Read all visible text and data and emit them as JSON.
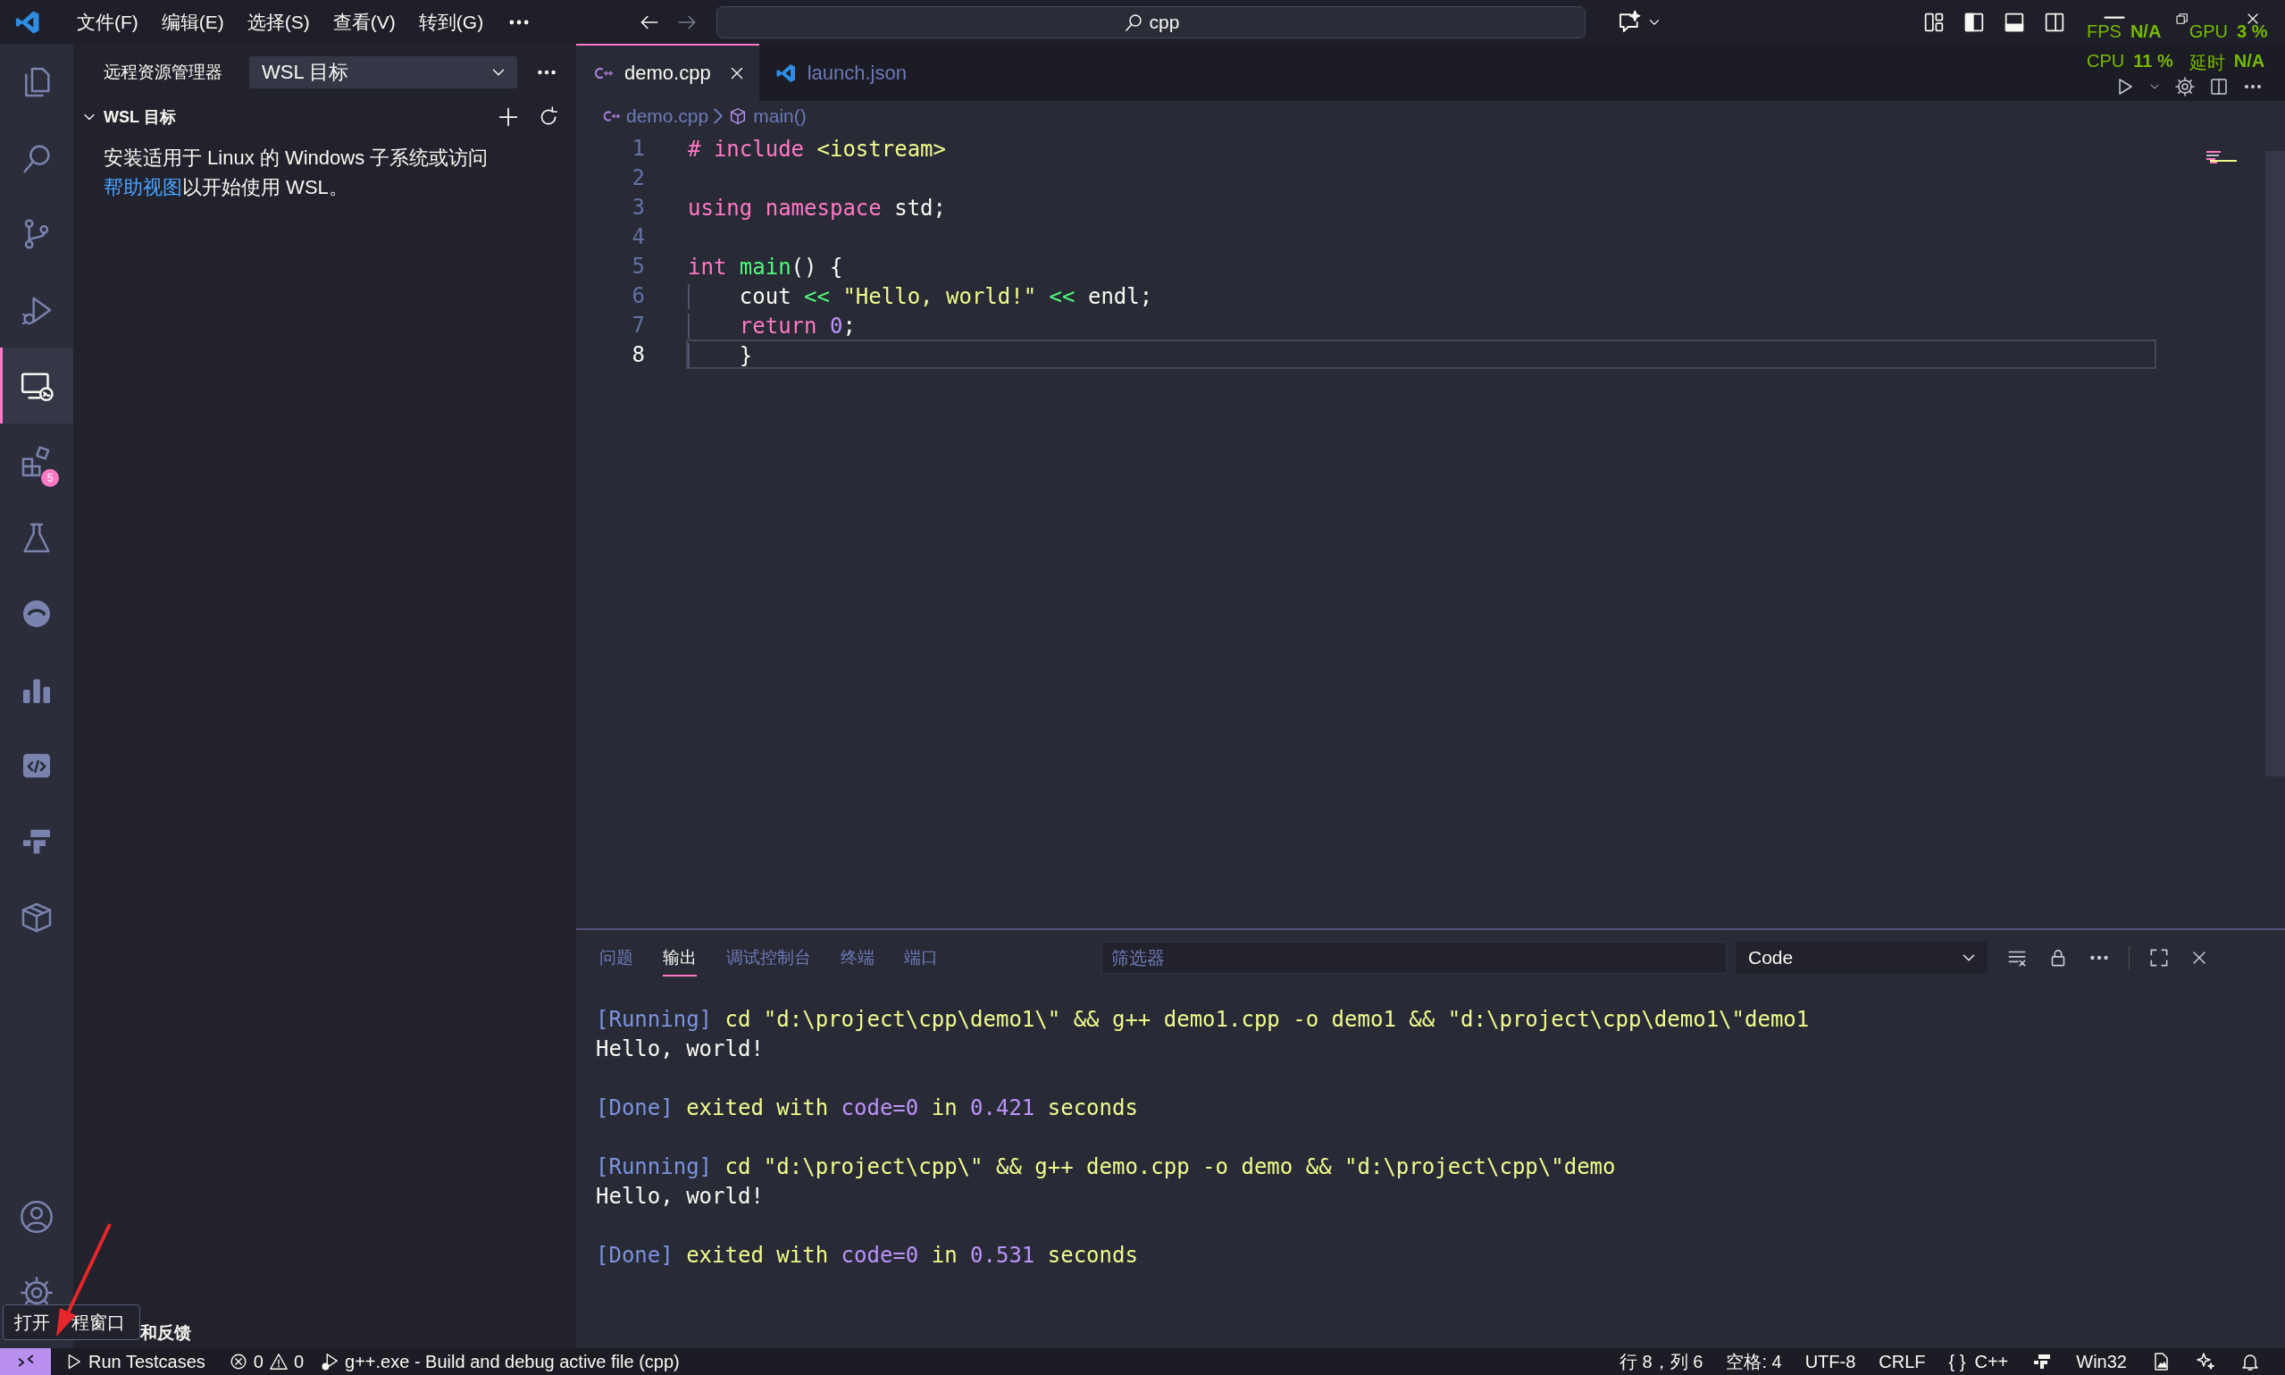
{
  "title_bar": {
    "menus": [
      "文件(F)",
      "编辑(E)",
      "选择(S)",
      "查看(V)",
      "转到(G)"
    ],
    "search": "cpp"
  },
  "activity_bar": {
    "items": [
      {
        "kind": "files",
        "selected": false
      },
      {
        "kind": "search",
        "selected": false
      },
      {
        "kind": "source-control",
        "selected": false
      },
      {
        "kind": "run-debug",
        "selected": false
      },
      {
        "kind": "remote",
        "selected": true
      },
      {
        "kind": "extensions",
        "selected": false,
        "badge": "5"
      },
      {
        "kind": "testing",
        "selected": false
      },
      {
        "kind": "round",
        "selected": false
      },
      {
        "kind": "chart",
        "selected": false
      },
      {
        "kind": "code-box",
        "selected": false
      },
      {
        "kind": "steps",
        "selected": false
      },
      {
        "kind": "package",
        "selected": false
      }
    ],
    "bottom": [
      {
        "kind": "account"
      },
      {
        "kind": "settings"
      }
    ]
  },
  "sidebar": {
    "title": "远程资源管理器",
    "target": "WSL 目标",
    "section": {
      "title": "WSL 目标",
      "expanded": true
    },
    "message": {
      "before": "安装适用于 Linux 的 Windows 子系统或访问",
      "link": "帮助视图",
      "after": "以开始使用 WSL。"
    },
    "footer_section": "和反馈"
  },
  "editor": {
    "tabs": [
      {
        "label": "demo.cpp",
        "kind": "cpp",
        "selected": true
      },
      {
        "label": "launch.json",
        "kind": "vscode",
        "selected": false
      }
    ],
    "breadcrumb": [
      {
        "label": "demo.cpp",
        "kind": "cpp"
      },
      {
        "label": "main()",
        "kind": "symbol"
      }
    ],
    "lines": [
      {
        "number": "1",
        "current": false,
        "tokens": [
          {
            "text": "# include",
            "kind": "keyword"
          },
          {
            "text": " <iostream>",
            "kind": "string"
          }
        ]
      },
      {
        "number": "2",
        "current": false
      },
      {
        "number": "3",
        "current": false,
        "tokens": [
          {
            "text": "using namespace",
            "kind": "keyword"
          },
          {
            "text": " std;",
            "kind": "plain"
          }
        ]
      },
      {
        "number": "4",
        "current": false
      },
      {
        "number": "5",
        "current": false,
        "tokens": [
          {
            "text": "int",
            "kind": "keyword"
          },
          {
            "text": " main",
            "kind": "function"
          },
          {
            "text": "() {",
            "kind": "plain"
          }
        ]
      },
      {
        "number": "6",
        "current": false,
        "indented": true,
        "tokens": [
          {
            "text": "cout ",
            "kind": "plain"
          },
          {
            "text": "<<",
            "kind": "operator"
          },
          {
            "text": " \"Hello, world!\" ",
            "kind": "string"
          },
          {
            "text": "<<",
            "kind": "operator"
          },
          {
            "text": " endl;",
            "kind": "plain"
          }
        ]
      },
      {
        "number": "7",
        "current": false,
        "indented": true,
        "tokens": [
          {
            "text": "return ",
            "kind": "keyword"
          },
          {
            "text": "0",
            "kind": "number"
          },
          {
            "text": ";",
            "kind": "plain"
          }
        ]
      },
      {
        "number": "8",
        "current": true,
        "indented": true,
        "tokens": [
          {
            "text": "}",
            "kind": "plain"
          }
        ]
      }
    ]
  },
  "panel": {
    "tabs": [
      {
        "label": "问题",
        "selected": false
      },
      {
        "label": "输出",
        "selected": true
      },
      {
        "label": "调试控制台",
        "selected": false
      },
      {
        "label": "终端",
        "selected": false
      },
      {
        "label": "端口",
        "selected": false
      }
    ],
    "filter_placeholder": "筛选器",
    "channel": "Code",
    "output": [
      {
        "lines": [
          {
            "tokens": [
              {
                "text": "[Running]",
                "kind": "tag"
              },
              {
                "text": " cd \"d:\\project\\cpp\\demo1\\\" && g++ demo1.cpp -o demo1 && \"d:\\project\\cpp\\demo1\\\"demo1",
                "kind": "command"
              }
            ]
          },
          {
            "tokens": [
              {
                "text": "Hello, world!",
                "kind": "plain"
              }
            ]
          }
        ]
      },
      {
        "lines": [
          {
            "tokens": [
              {
                "text": "[Done]",
                "kind": "tag"
              },
              {
                "text": " exited with ",
                "kind": "command"
              },
              {
                "text": "code=0",
                "kind": "value"
              },
              {
                "text": " in ",
                "kind": "command"
              },
              {
                "text": "0.421",
                "kind": "value"
              },
              {
                "text": " seconds",
                "kind": "command"
              }
            ]
          }
        ]
      },
      {
        "lines": [
          {
            "tokens": [
              {
                "text": "[Running]",
                "kind": "tag"
              },
              {
                "text": " cd \"d:\\project\\cpp\\\" && g++ demo.cpp -o demo && \"d:\\project\\cpp\\\"demo",
                "kind": "command"
              }
            ]
          },
          {
            "tokens": [
              {
                "text": "Hello, world!",
                "kind": "plain"
              }
            ]
          }
        ]
      },
      {
        "lines": [
          {
            "tokens": [
              {
                "text": "[Done]",
                "kind": "tag"
              },
              {
                "text": " exited with ",
                "kind": "command"
              },
              {
                "text": "code=0",
                "kind": "value"
              },
              {
                "text": " in ",
                "kind": "command"
              },
              {
                "text": "0.531",
                "kind": "value"
              },
              {
                "text": " seconds",
                "kind": "command"
              }
            ]
          }
        ]
      }
    ]
  },
  "status_bar": {
    "left": [
      {
        "kind": "remote"
      },
      {
        "kind": "run",
        "text": "Run Testcases"
      },
      {
        "kind": "problems",
        "errors": "0",
        "warnings": "0"
      },
      {
        "kind": "debug",
        "text": "g++.exe - Build and debug active file (cpp)"
      }
    ],
    "right": [
      {
        "kind": "text",
        "text": "行 8，列 6"
      },
      {
        "kind": "text",
        "text": "空格: 4"
      },
      {
        "kind": "text",
        "text": "UTF-8"
      },
      {
        "kind": "text",
        "text": "CRLF"
      },
      {
        "kind": "language",
        "braces": "{ }",
        "text": "C++"
      },
      {
        "kind": "steps"
      },
      {
        "kind": "text",
        "text": "Win32"
      },
      {
        "kind": "layout"
      },
      {
        "kind": "sparkle"
      },
      {
        "kind": "bell"
      }
    ]
  },
  "overlay": {
    "stats": [
      {
        "label": "FPS",
        "value": "N/A"
      },
      {
        "label": "GPU",
        "value": "3 %"
      },
      {
        "label": "CPU",
        "value": "11 %"
      },
      {
        "label": "延时",
        "value": "N/A"
      }
    ]
  },
  "tooltip": {
    "before": "打开",
    "after": "程窗口"
  }
}
